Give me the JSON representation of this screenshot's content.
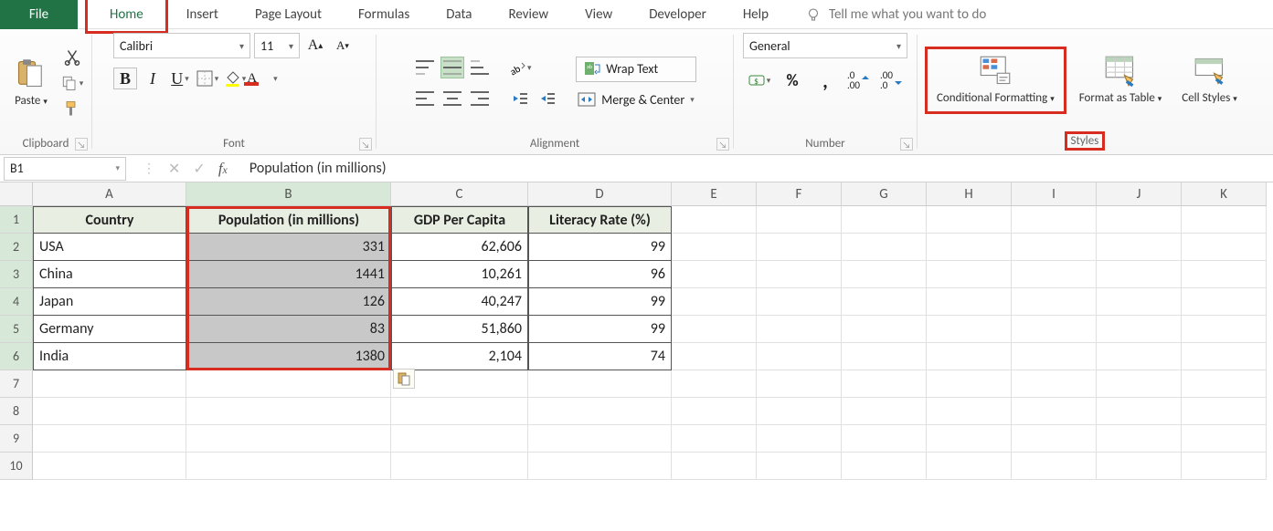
{
  "tabs": {
    "file": "File",
    "home": "Home",
    "insert": "Insert",
    "pageLayout": "Page Layout",
    "formulas": "Formulas",
    "data": "Data",
    "review": "Review",
    "view": "View",
    "developer": "Developer",
    "help": "Help",
    "tellMe": "Tell me what you want to do"
  },
  "ribbon": {
    "clipboard": {
      "paste": "Paste",
      "label": "Clipboard"
    },
    "font": {
      "name": "Calibri",
      "size": "11",
      "label": "Font",
      "bold": "B",
      "italic": "I",
      "underline": "U"
    },
    "alignment": {
      "wrap": "Wrap Text",
      "merge": "Merge & Center",
      "label": "Alignment"
    },
    "number": {
      "format": "General",
      "label": "Number"
    },
    "styles": {
      "cf": "Conditional Formatting",
      "table": "Format as Table",
      "cell": "Cell Styles",
      "label": "Styles"
    }
  },
  "formulaBar": {
    "nameBox": "B1",
    "value": "Population (in millions)"
  },
  "grid": {
    "columns": [
      "A",
      "B",
      "C",
      "D",
      "E",
      "F",
      "G",
      "H",
      "I",
      "J",
      "K"
    ],
    "colWidths": {
      "A": 168,
      "B": 224,
      "C": 150,
      "D": 157,
      "rest": 93
    },
    "headers": [
      "Country",
      "Population (in millions)",
      "GDP Per Capita",
      "Literacy Rate (%)"
    ],
    "rows": [
      {
        "n": 2,
        "country": "USA",
        "pop": "331",
        "gdp": "62,606",
        "lit": "99"
      },
      {
        "n": 3,
        "country": "China",
        "pop": "1441",
        "gdp": "10,261",
        "lit": "96"
      },
      {
        "n": 4,
        "country": "Japan",
        "pop": "126",
        "gdp": "40,247",
        "lit": "99"
      },
      {
        "n": 5,
        "country": "Germany",
        "pop": "83",
        "gdp": "51,860",
        "lit": "99"
      },
      {
        "n": 6,
        "country": "India",
        "pop": "1380",
        "gdp": "2,104",
        "lit": "74"
      }
    ],
    "emptyRows": [
      7,
      8,
      9,
      10
    ]
  },
  "selection": {
    "activeColumn": "B",
    "activeRange": "B1:B6"
  },
  "highlights": [
    "home-tab",
    "conditional-formatting",
    "styles-label",
    "column-B"
  ],
  "chart_data": {
    "type": "table",
    "title": "",
    "columns": [
      "Country",
      "Population (in millions)",
      "GDP Per Capita",
      "Literacy Rate (%)"
    ],
    "rows": [
      [
        "USA",
        331,
        62606,
        99
      ],
      [
        "China",
        1441,
        10261,
        96
      ],
      [
        "Japan",
        126,
        40247,
        99
      ],
      [
        "Germany",
        83,
        51860,
        99
      ],
      [
        "India",
        1380,
        2104,
        74
      ]
    ]
  }
}
